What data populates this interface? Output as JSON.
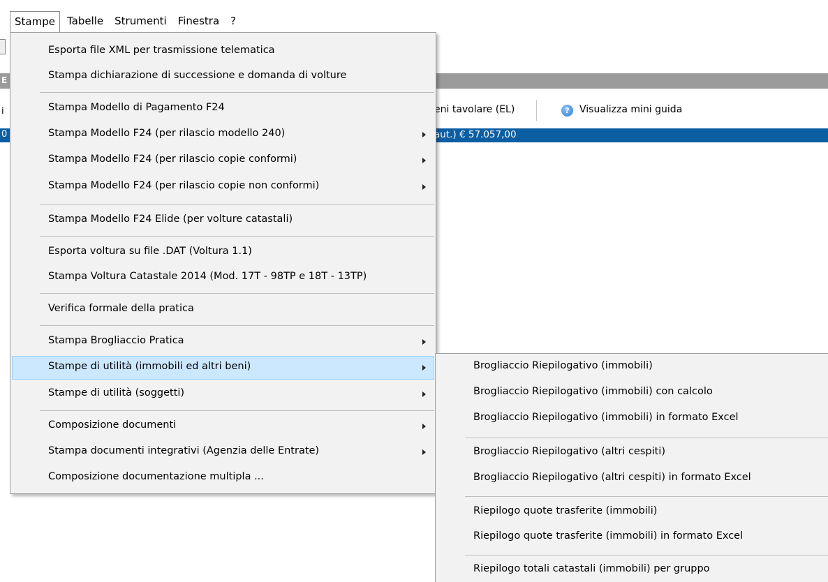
{
  "menubar": {
    "items": [
      {
        "label": "Stampe"
      },
      {
        "label": "Tabelle"
      },
      {
        "label": "Strumenti"
      },
      {
        "label": "Finestra"
      },
      {
        "label": "?"
      }
    ]
  },
  "background": {
    "titlebar_letter": "E",
    "toolbar_left_fragment": "i",
    "toolbar_text_fragment": "eni tavolare (EL)",
    "help_label": "Visualizza mini guida",
    "selected_row_left": "0",
    "selected_row_amount": "aut.) € 57.057,00"
  },
  "menu": {
    "items": [
      {
        "label": "Esporta file XML per trasmissione telematica",
        "submenu": false
      },
      {
        "label": "Stampa dichiarazione di successione e domanda di volture",
        "submenu": false
      },
      {
        "label": "Stampa Modello di Pagamento F24",
        "submenu": false
      },
      {
        "label": "Stampa Modello F24 (per rilascio modello 240)",
        "submenu": true
      },
      {
        "label": "Stampa Modello F24 (per rilascio copie conformi)",
        "submenu": true
      },
      {
        "label": "Stampa Modello F24 (per rilascio copie non conformi)",
        "submenu": true
      },
      {
        "label": "Stampa Modello F24 Elide (per volture catastali)",
        "submenu": false
      },
      {
        "label": "Esporta voltura su file .DAT (Voltura 1.1)",
        "submenu": false
      },
      {
        "label": "Stampa Voltura Catastale 2014 (Mod. 17T - 98TP e 18T - 13TP)",
        "submenu": false
      },
      {
        "label": "Verifica formale della pratica",
        "submenu": false
      },
      {
        "label": "Stampa Brogliaccio Pratica",
        "submenu": true
      },
      {
        "label": "Stampe di utilità (immobili ed altri beni)",
        "submenu": true
      },
      {
        "label": "Stampe di utilità (soggetti)",
        "submenu": true
      },
      {
        "label": "Composizione documenti",
        "submenu": true
      },
      {
        "label": "Stampa documenti integrativi (Agenzia delle Entrate)",
        "submenu": true
      },
      {
        "label": "Composizione documentazione multipla ...",
        "submenu": false
      }
    ]
  },
  "submenu": {
    "items": [
      {
        "label": "Brogliaccio Riepilogativo (immobili)"
      },
      {
        "label": "Brogliaccio Riepilogativo (immobili) con calcolo"
      },
      {
        "label": "Brogliaccio Riepilogativo (immobili) in formato Excel"
      },
      {
        "label": "Brogliaccio Riepilogativo (altri cespiti)"
      },
      {
        "label": "Brogliaccio Riepilogativo (altri cespiti) in formato Excel"
      },
      {
        "label": "Riepilogo quote trasferite (immobili)"
      },
      {
        "label": "Riepilogo quote trasferite (immobili) in formato Excel"
      },
      {
        "label": "Riepilogo totali catastali (immobili) per gruppo"
      }
    ]
  }
}
